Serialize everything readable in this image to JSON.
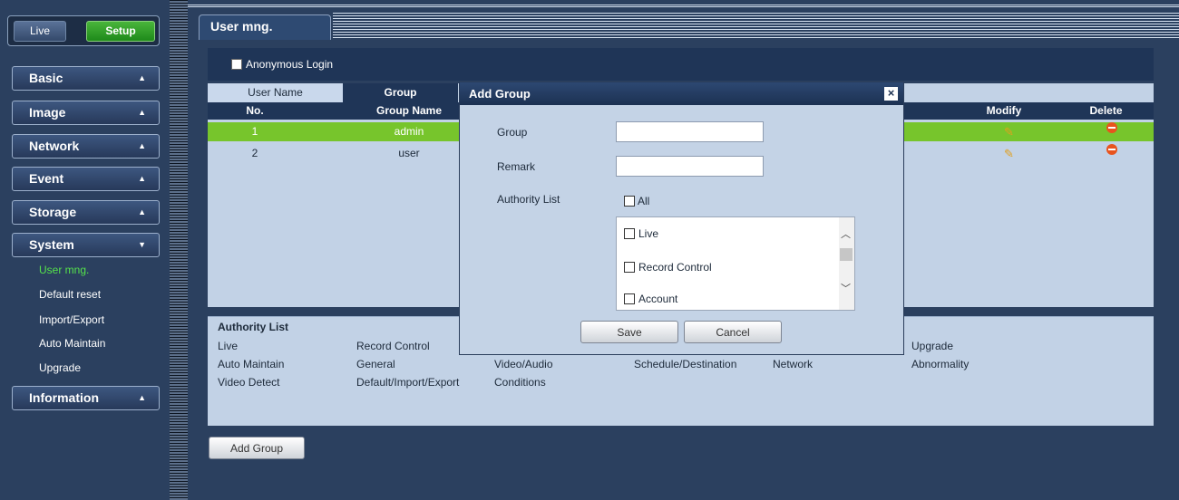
{
  "topnav": {
    "live_label": "Live",
    "setup_label": "Setup"
  },
  "sidebar": {
    "menus": [
      {
        "label": "Basic",
        "arrow": "▲"
      },
      {
        "label": "Image",
        "arrow": "▲"
      },
      {
        "label": "Network",
        "arrow": "▲"
      },
      {
        "label": "Event",
        "arrow": "▲"
      },
      {
        "label": "Storage",
        "arrow": "▲"
      },
      {
        "label": "System",
        "arrow": "▼"
      },
      {
        "label": "Information",
        "arrow": "▲"
      }
    ],
    "system_items": [
      {
        "label": "User mng."
      },
      {
        "label": "Default reset"
      },
      {
        "label": "Import/Export"
      },
      {
        "label": "Auto Maintain"
      },
      {
        "label": "Upgrade"
      }
    ]
  },
  "page": {
    "tab_title": "User mng.",
    "anonymous_login_label": "Anonymous Login"
  },
  "subtabs": {
    "user_name": "User Name",
    "group": "Group"
  },
  "table": {
    "headers": {
      "no": "No.",
      "group_name": "Group Name",
      "modify": "Modify",
      "delete": "Delete"
    },
    "rows": [
      {
        "no": "1",
        "group_name": "admin",
        "selected": true
      },
      {
        "no": "2",
        "group_name": "user",
        "selected": false
      }
    ]
  },
  "authority_panel": {
    "title": "Authority List",
    "items": [
      "Live",
      "Record Control",
      "Upgrade",
      "Auto Maintain",
      "General",
      "Video/Audio",
      "Schedule/Destination",
      "Network",
      "Abnormality",
      "Video Detect",
      "Default/Import/Export",
      "Conditions"
    ]
  },
  "add_group_button": "Add Group",
  "dialog": {
    "title": "Add Group",
    "close_glyph": "×",
    "group_label": "Group",
    "group_value": "",
    "remark_label": "Remark",
    "remark_value": "",
    "authority_label": "Authority List",
    "all_label": "All",
    "options": [
      "Live",
      "Record Control",
      "Account"
    ],
    "save_label": "Save",
    "cancel_label": "Cancel"
  },
  "colors": {
    "selected_row": "#77c52c",
    "active_menu": "#55e24b",
    "setup_button": "#1e8a1a"
  },
  "icons": {
    "modify": "pencil-icon",
    "delete": "delete-icon"
  }
}
